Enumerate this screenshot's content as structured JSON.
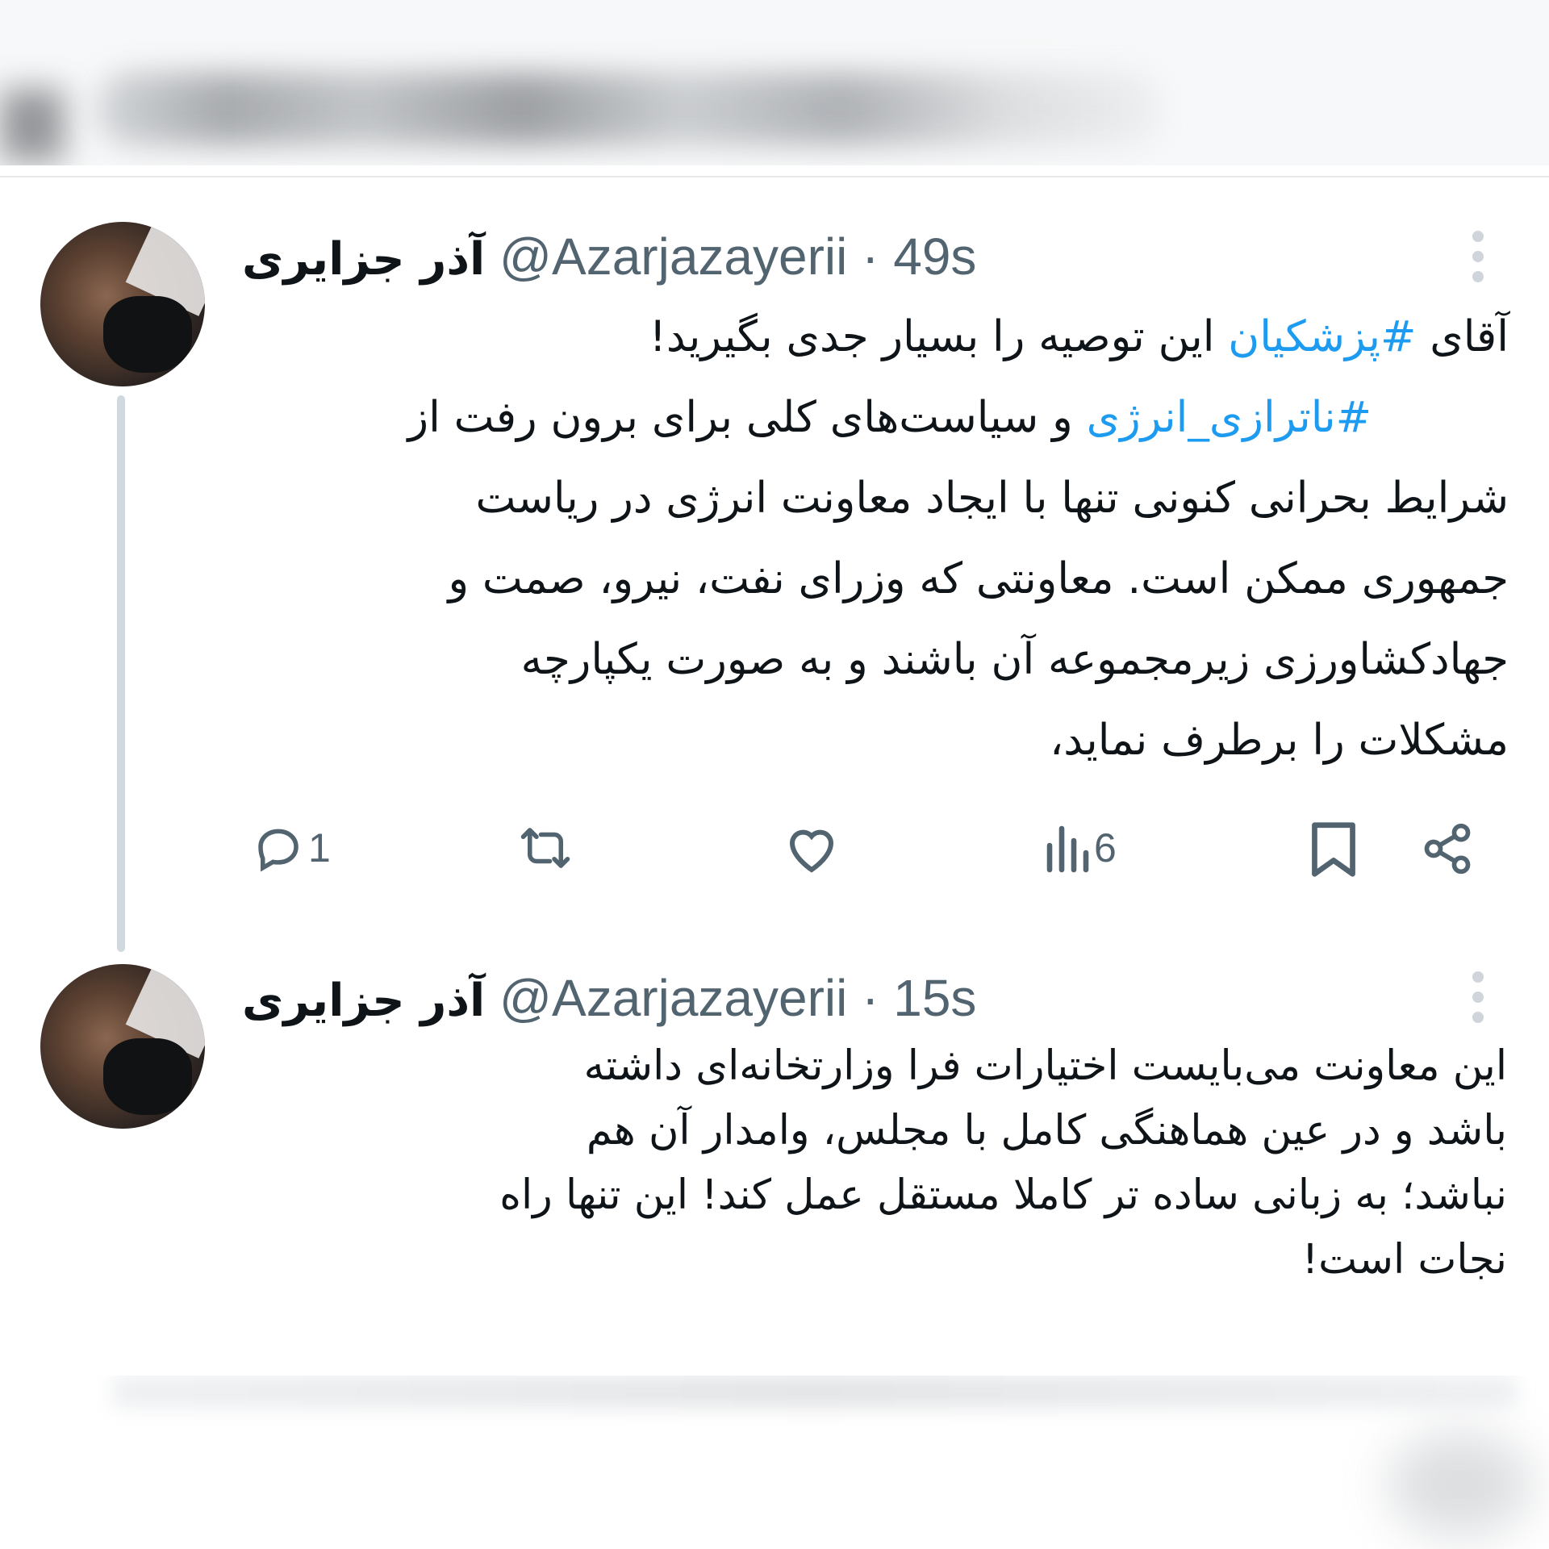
{
  "colors": {
    "text": "#0f1419",
    "muted": "#536471",
    "hashtag": "#1d9bf0",
    "thread_line": "#cfd9de"
  },
  "tweets": [
    {
      "display_name": "آذر جزایری",
      "handle": "@Azarjazayerii",
      "separator": "·",
      "time": "49s",
      "lines": [
        {
          "before": "آقای ",
          "tag": "#پزشکیان",
          "after": " این توصیه را بسیار جدی بگیرید!"
        },
        {
          "before": "",
          "tag": "#ناترازی_انرژی",
          "after": " و سیاست‌های کلی برای برون رفت از"
        },
        {
          "before": "شرایط بحرانی کنونی تنها با ایجاد معاونت انرژی در ریاست",
          "tag": "",
          "after": ""
        },
        {
          "before": "جمهوری ممکن است. معاونتی که وزرای نفت، نیرو، صمت و",
          "tag": "",
          "after": ""
        },
        {
          "before": "جهادکشاورزی زیرمجموعه آن باشند و به صورت یکپارچه",
          "tag": "",
          "after": ""
        },
        {
          "before": "مشکلات را برطرف نماید،",
          "tag": "",
          "after": ""
        }
      ],
      "actions": {
        "reply_icon": "reply-icon",
        "reply_count": "1",
        "retweet_icon": "retweet-icon",
        "like_icon": "heart-icon",
        "views_icon": "views-icon",
        "views_count": "6",
        "bookmark_icon": "bookmark-icon",
        "share_icon": "share-icon"
      }
    },
    {
      "display_name": "آذر جزایری",
      "handle": "@Azarjazayerii",
      "separator": "·",
      "time": "15s",
      "lines": [
        {
          "before": "این معاونت می‌بایست اختیارات فرا وزارتخانه‌ای داشته",
          "tag": "",
          "after": ""
        },
        {
          "before": "باشد و  در عین هماهنگی کامل با مجلس، وامدار آن هم",
          "tag": "",
          "after": ""
        },
        {
          "before": "نباشد؛ به زبانی ساده تر کاملا مستقل عمل کند! این تنها راه",
          "tag": "",
          "after": ""
        },
        {
          "before": "نجات است!",
          "tag": "",
          "after": ""
        }
      ]
    }
  ]
}
